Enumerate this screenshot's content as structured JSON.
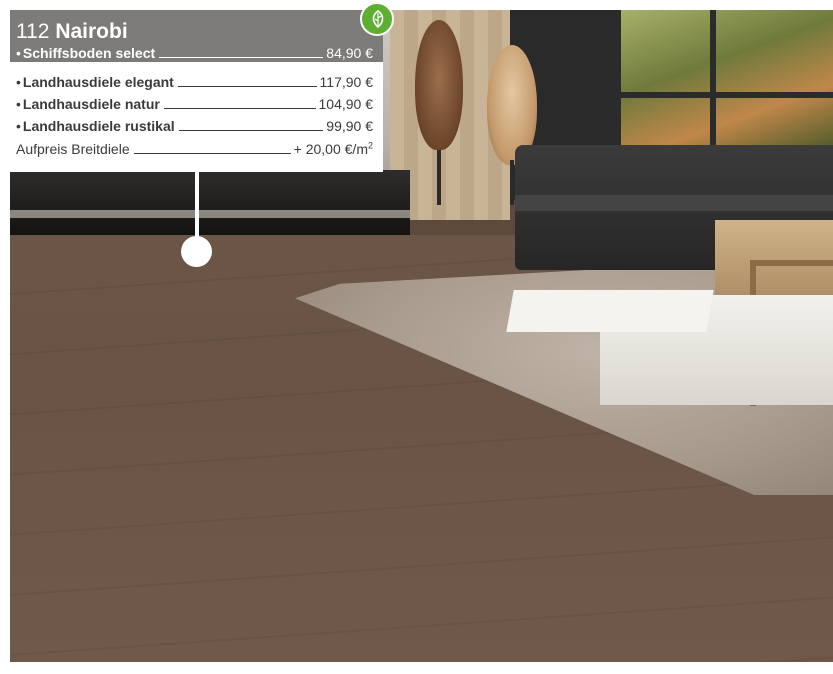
{
  "product": {
    "number": "112",
    "name": "Nairobi",
    "primary": {
      "bullet": "•",
      "label": "Schiffsboden select",
      "price": "84,90 €"
    }
  },
  "variants": [
    {
      "bullet": "•",
      "label": "Landhausdiele elegant",
      "price": "117,90 €"
    },
    {
      "bullet": "•",
      "label": "Landhausdiele natur",
      "price": "104,90 €"
    },
    {
      "bullet": "•",
      "label": "Landhausdiele rustikal",
      "price": "99,90 €"
    }
  ],
  "surcharge": {
    "label": "Aufpreis Breitdiele",
    "price": "+ 20,00 €/m",
    "unit_sup": "2"
  },
  "badge": {
    "icon": "eco-leaf-icon",
    "color": "#5fae34"
  },
  "colors": {
    "panel_header": "#7c7b7a",
    "panel_body": "#ffffff",
    "text_dark": "#3b3b3b",
    "floor": "#6b5546"
  }
}
